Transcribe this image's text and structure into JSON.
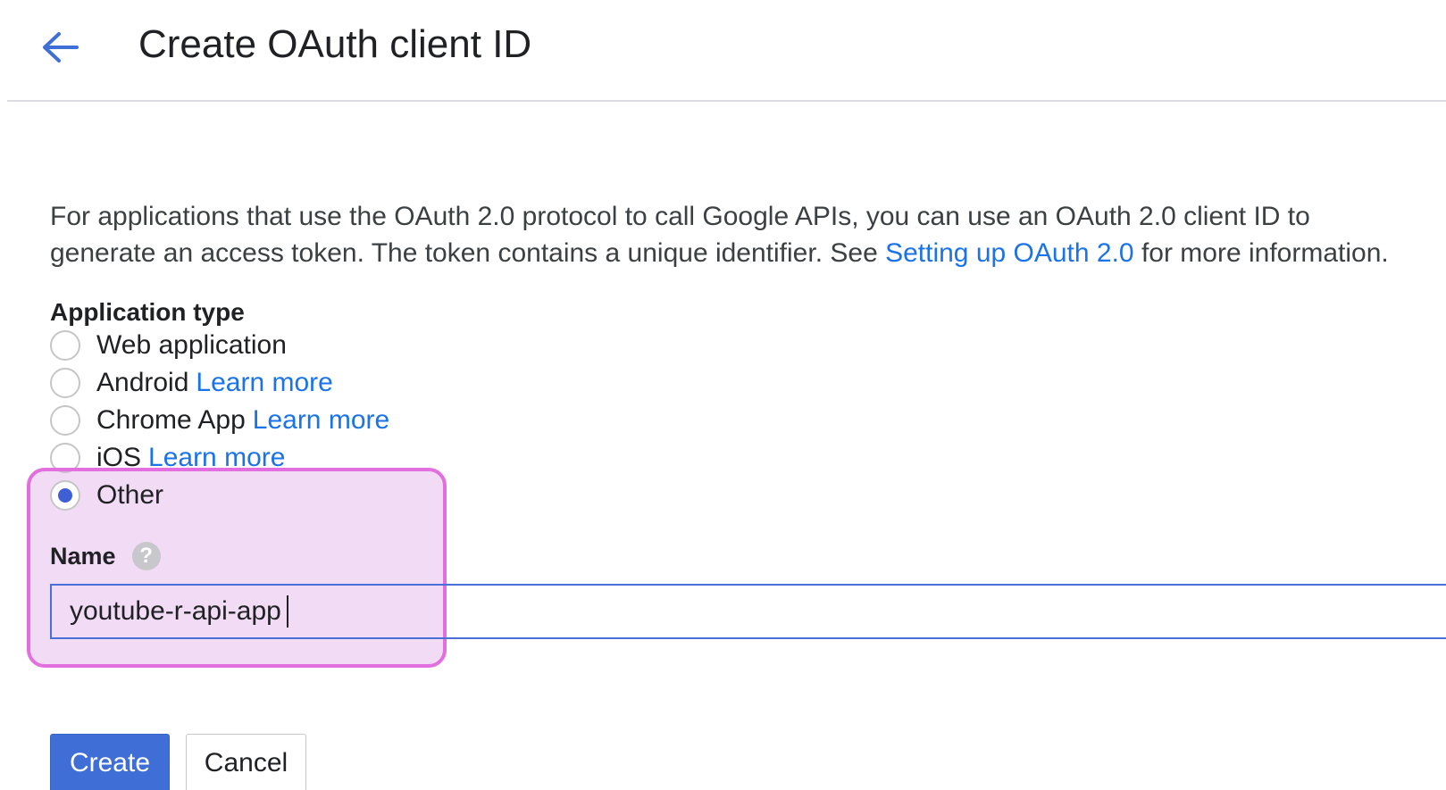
{
  "header": {
    "title": "Create OAuth client ID",
    "back_icon": "arrow-left-icon"
  },
  "description": {
    "line1": "For applications that use the OAuth 2.0 protocol to call Google APIs, you can use an OAuth 2.0 client ID to",
    "line2_prefix": "generate an access token. The token contains a unique identifier. See ",
    "link_text": "Setting up OAuth 2.0",
    "line2_suffix": " for more information."
  },
  "application_type": {
    "label": "Application type",
    "learn_more": "Learn more",
    "options": [
      {
        "label": "Web application",
        "selected": false
      },
      {
        "label": "Android",
        "selected": false
      },
      {
        "label": "Chrome App",
        "selected": false
      },
      {
        "label": "iOS",
        "selected": false
      },
      {
        "label": "Other",
        "selected": true
      }
    ]
  },
  "name_field": {
    "label": "Name",
    "help_icon": "question-mark-icon",
    "help_glyph": "?",
    "value": "youtube-r-api-app"
  },
  "actions": {
    "create_label": "Create",
    "cancel_label": "Cancel"
  },
  "colors": {
    "accent": "#1a73e8",
    "radio_selected": "#3f5fd4",
    "primary_button": "#3f6fd6",
    "highlight_border": "#e36ee0",
    "highlight_fill": "#dea0e6"
  }
}
